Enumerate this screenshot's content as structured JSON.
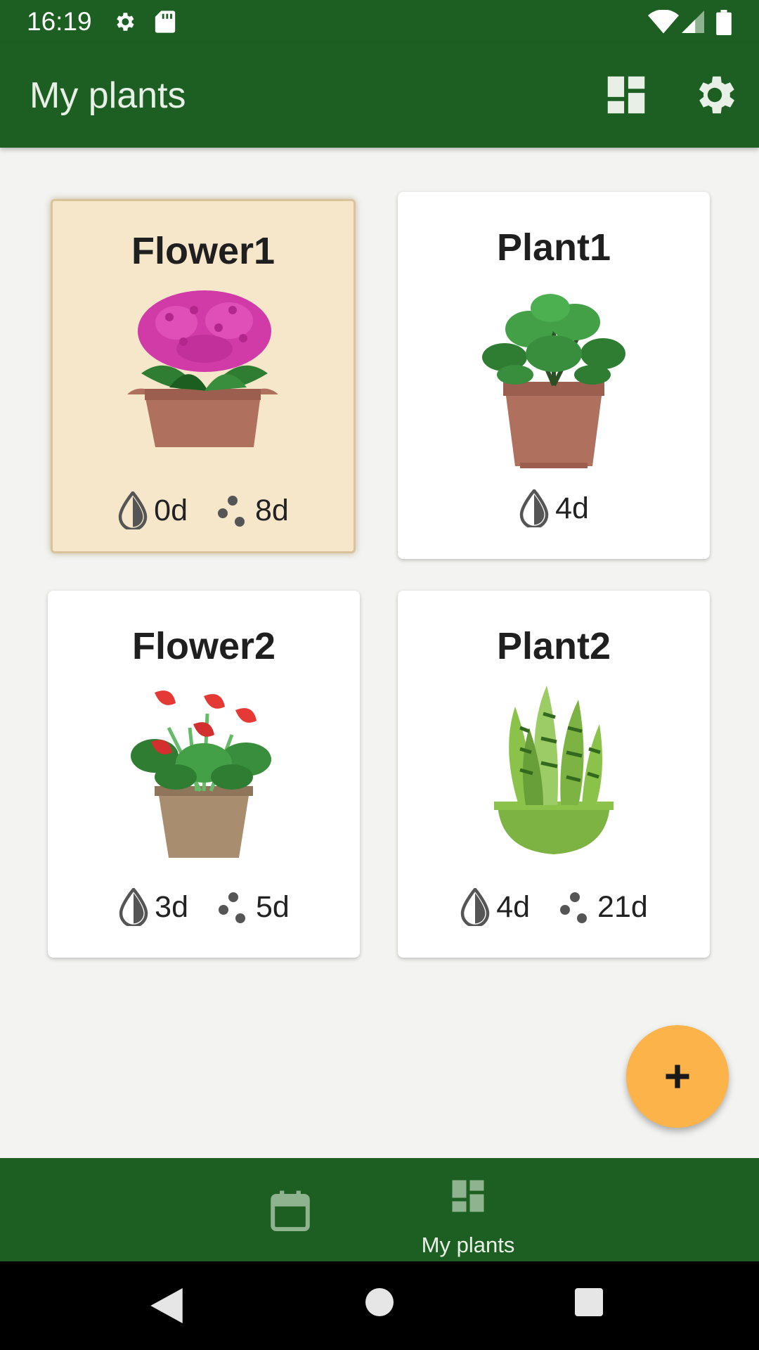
{
  "status_bar": {
    "time": "16:19",
    "icons": [
      "gear-icon",
      "sd-card-icon",
      "wifi-icon",
      "signal-icon",
      "battery-icon"
    ]
  },
  "app_bar": {
    "title": "My plants",
    "actions": [
      "dashboard-icon",
      "settings-icon"
    ]
  },
  "plants": [
    {
      "name": "Flower1",
      "water": "0d",
      "fertilize": "8d",
      "selected": true
    },
    {
      "name": "Plant1",
      "water": "4d"
    },
    {
      "name": "Flower2",
      "water": "3d",
      "fertilize": "5d"
    },
    {
      "name": "Plant2",
      "water": "4d",
      "fertilize": "21d"
    }
  ],
  "fab": {
    "icon": "plus-icon"
  },
  "bottom_nav": {
    "items": [
      {
        "icon": "calendar-icon",
        "label": ""
      },
      {
        "icon": "dashboard-icon",
        "label": "My plants",
        "active": true
      }
    ]
  },
  "system_nav": [
    "back-icon",
    "home-icon",
    "recents-icon"
  ],
  "colors": {
    "primary": "#1d5f22",
    "accent": "#fbb34a",
    "selected_card": "#f6e7ca",
    "background": "#f3f4f2"
  }
}
